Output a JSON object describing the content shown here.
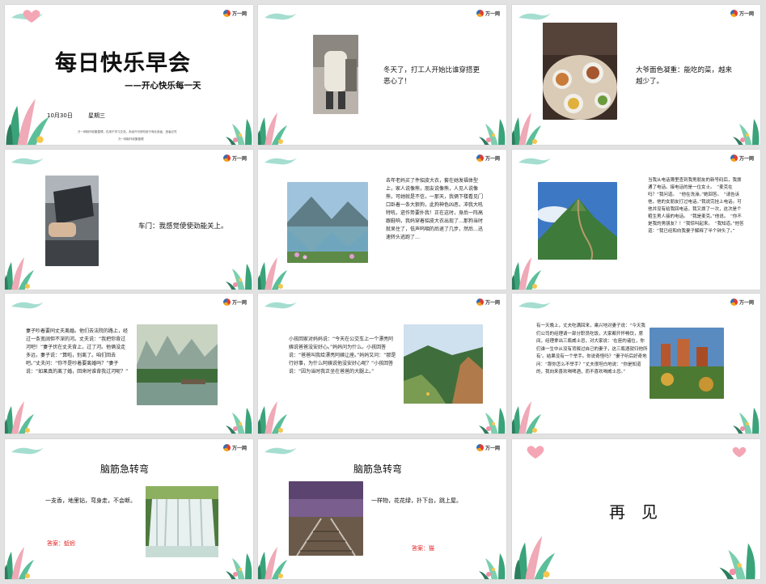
{
  "slide1": {
    "title": "每日快乐早会",
    "subtitle": "——开心快乐每一天",
    "date": "10月30日",
    "weekday": "星期三",
    "footer_line1": "万一网制作收集整理，仅用于学习交流，未经许可请勿用于商业用途，违者必究",
    "footer_line2": "万一网制作收集整理"
  },
  "slide2": {
    "caption": "冬天了，打工人开始比谁穿搭更恶心了！"
  },
  "slide3": {
    "caption": "大爷面色凝重：能吃的菜，越来越少了。"
  },
  "slide4": {
    "caption": "车门：我感觉使使劲能关上。"
  },
  "slide5": {
    "text": "去年老妈买了件貂皮大衣，套在她发福体型上，家人说像熊，朋友说像熊，人见人说像熊，可她就是不信，一那天，我俩下楼看见门口卧着一条大狼狗，此狗神色凶恶，冲我大吼特吼，迸作势要扑我！正在这时，身后一阵高跟鞋响，我妈穿着貂皮大衣出现了…那狗当时就呆住了，低声呜咽的后退了几步，然后…迅速转头逃跑了…"
  },
  "slide6": {
    "text": "当我从电话簿里查到我男朋友的新号码后，我拨通了电话。接电话的是一位女士。　“麦克在吗？”我问道。　“他在洗澡。”她回答。　“请告诉他，他的女朋友打过电话。”我说完挂上电话。可他并没有给我回电话，我又拨了一次，这次是个粗生男人接的电话。　“我是麦克。”他说。　“你不是我的男朋友？！”我惊叫起来。　“我知道。”他答道：“我已经和向我妻子解释了半个钟头了。”"
  },
  "slide7": {
    "text": "妻子吵着要同丈夫离婚。他们去法院的路上，经过一条宽阔但不深的河。丈夫说：“我把你背过河吧！”妻子伏在丈夫背上，过了河。他俩没走多远，妻子说：“算啦，别离了。咱们回去吧。”丈夫问：“你不是吵着要离婚吗？”妻子说：“如果真的离了婚，回来时谁背我过河呢？”"
  },
  "slide8": {
    "text": "小孩回家对妈妈说：“今天在公交车上一个漂亮阿姨说爸爸没安好心。”妈妈问为什么。小孩回答说：“爸爸叫我给漂亮阿姨让座。”妈妈又问：“那是行好事，为什么阿姨说他没安好心呢？”小孩回答说：“因为当时我正坐在爸爸的大腿上。”"
  },
  "slide9": {
    "text": "有一天晚上，丈夫吃满回来，乘兴地对妻子说：“今天我们公司的经理请一部分职员吃饭，大家都开怀畅饮，席间，经理拿出三瓶威士忌，对大家说：‘在座的诸位，你们谁一生中从没有背叛过自己的妻子，这三瓶酒就归他所有’。结果没有一个举手。你说奇怪吗？”妻子听后好奇地问：“那你怎么不举手？”丈夫很坦白地说：“你是知道的，我向来喜欢喝啤酒，而不喜欢喝威士忌。”"
  },
  "slide10": {
    "title": "脑筋急转弯",
    "riddle": "一支香，地里钻，弯身走，不会断。",
    "answer": "答案：蚯蚓"
  },
  "slide11": {
    "title": "脑筋急转弯",
    "riddle": "一样物，花花绿，扑下台，跳上屋。",
    "answer": "答案：猫"
  },
  "slide12": {
    "text": "再　见"
  },
  "brand": {
    "logo_text": "万一网"
  }
}
